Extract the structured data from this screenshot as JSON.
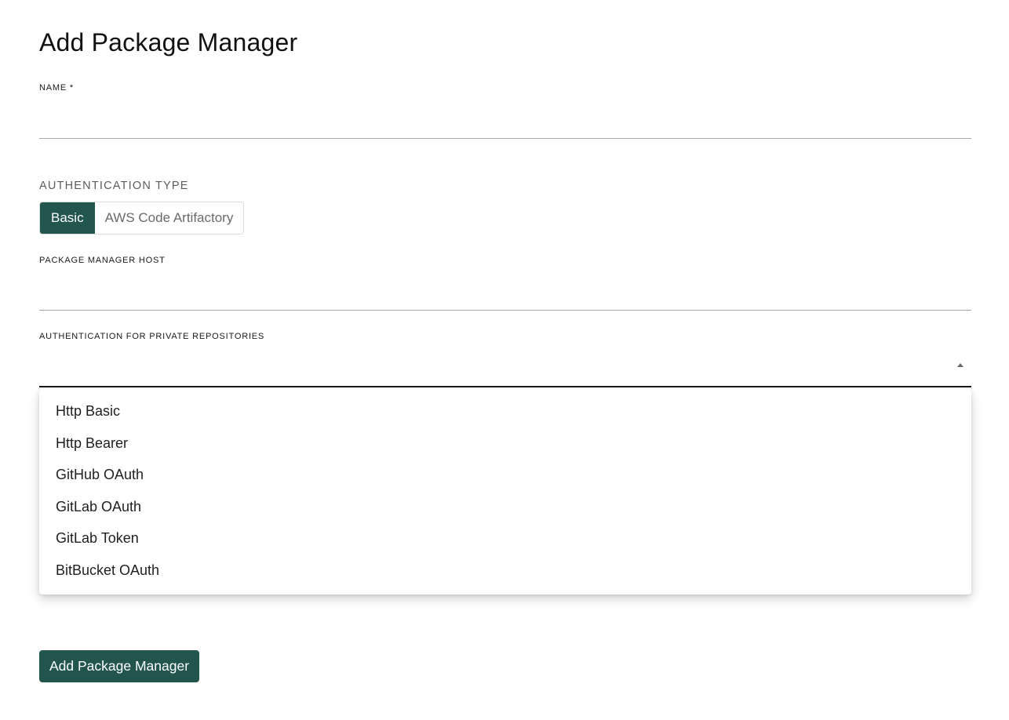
{
  "page": {
    "title": "Add Package Manager"
  },
  "form": {
    "name": {
      "label": "NAME *",
      "value": ""
    },
    "auth_type": {
      "label": "AUTHENTICATION TYPE",
      "options": [
        "Basic",
        "AWS Code Artifactory"
      ],
      "selected": "Basic"
    },
    "host": {
      "label": "PACKAGE MANAGER HOST",
      "value": ""
    },
    "private_auth": {
      "label": "AUTHENTICATION FOR PRIVATE REPOSITORIES",
      "value": "",
      "expanded": true,
      "options": [
        "Http Basic",
        "Http Bearer",
        "GitHub OAuth",
        "GitLab OAuth",
        "GitLab Token",
        "BitBucket OAuth"
      ]
    },
    "submit_label": "Add Package Manager"
  },
  "colors": {
    "primary": "#21554e",
    "text": "#1a1a1a",
    "muted": "#5c5c5c",
    "divider": "#a8a8a8"
  },
  "icons": {
    "dropdown": "caret-up-icon"
  }
}
